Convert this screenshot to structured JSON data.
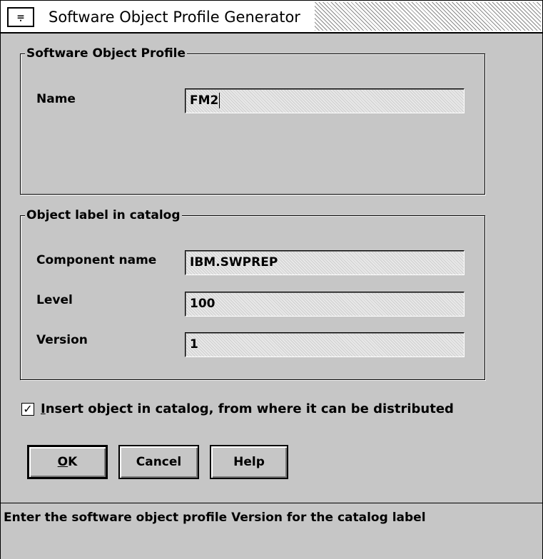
{
  "window": {
    "title": "Software Object Profile Generator",
    "system_menu_icon": "minimize-icon"
  },
  "profile_group": {
    "title": "Software Object Profile",
    "name_label": "Name",
    "name_value": "FM2"
  },
  "catalog_group": {
    "title": "Object label in catalog",
    "component_label": "Component name",
    "component_value": "IBM.SWPREP",
    "level_label": "Level",
    "level_value": "100",
    "version_label": "Version",
    "version_value": "1"
  },
  "insert_checkbox": {
    "checked": true,
    "mnemonic": "I",
    "label_rest": "nsert object in catalog, from where it can be distributed"
  },
  "buttons": {
    "ok_mnemonic": "O",
    "ok_rest": "K",
    "cancel": "Cancel",
    "help": "Help"
  },
  "status": {
    "text": "Enter the software object profile Version for the catalog label"
  }
}
